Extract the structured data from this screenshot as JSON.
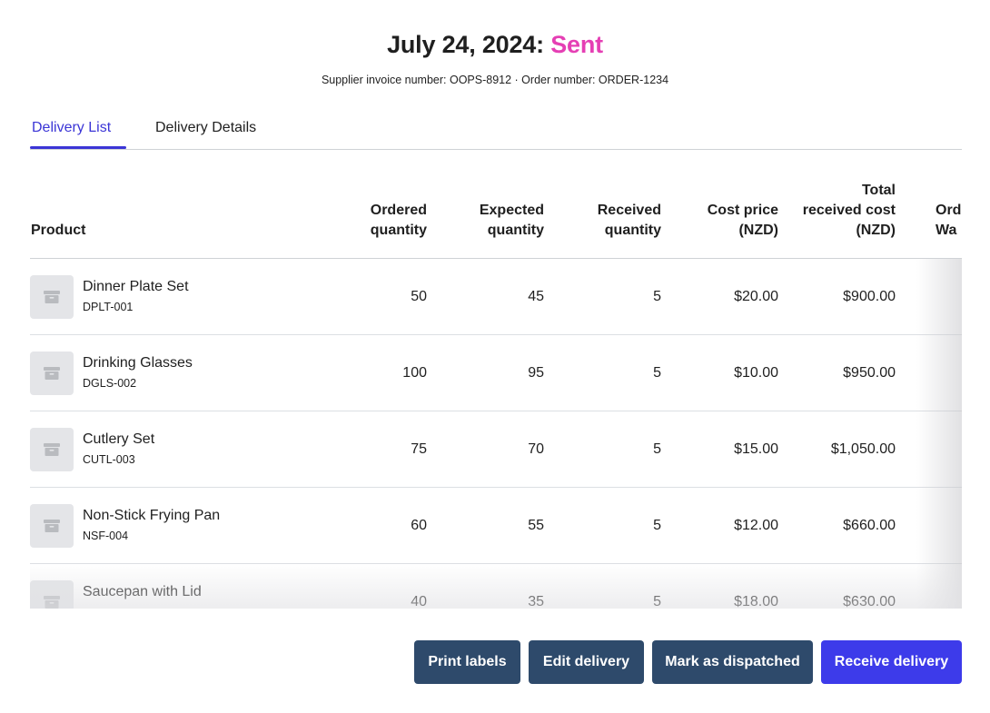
{
  "header": {
    "date": "July 24, 2024:",
    "status": "Sent",
    "status_color": "#e53fb4",
    "subtitle": "Supplier invoice number: OOPS-8912 ·  Order number: ORDER-1234"
  },
  "tabs": [
    {
      "label": "Delivery List",
      "active": true
    },
    {
      "label": "Delivery Details",
      "active": false
    }
  ],
  "table": {
    "columns": [
      "Product",
      "Ordered\nquantity",
      "Expected\nquantity",
      "Received\nquantity",
      "Cost price\n(NZD)",
      "Total\nreceived cost\n(NZD)",
      "Ord\nWa"
    ],
    "rows": [
      {
        "name": "Dinner Plate Set",
        "sku": "DPLT-001",
        "ordered": "50",
        "expected": "45",
        "received": "5",
        "cost": "$20.00",
        "total": "$900.00"
      },
      {
        "name": "Drinking Glasses",
        "sku": "DGLS-002",
        "ordered": "100",
        "expected": "95",
        "received": "5",
        "cost": "$10.00",
        "total": "$950.00"
      },
      {
        "name": "Cutlery Set",
        "sku": "CUTL-003",
        "ordered": "75",
        "expected": "70",
        "received": "5",
        "cost": "$15.00",
        "total": "$1,050.00"
      },
      {
        "name": "Non-Stick Frying Pan",
        "sku": "NSF-004",
        "ordered": "60",
        "expected": "55",
        "received": "5",
        "cost": "$12.00",
        "total": "$660.00"
      },
      {
        "name": "Saucepan with Lid",
        "sku": "",
        "ordered": "40",
        "expected": "35",
        "received": "5",
        "cost": "$18.00",
        "total": "$630.00"
      }
    ],
    "thumbnail_icon": "archive-box-icon"
  },
  "actions": {
    "print_labels": "Print labels",
    "edit_delivery": "Edit delivery",
    "mark_dispatched": "Mark as dispatched",
    "receive_delivery": "Receive delivery",
    "primary_color": "#3d3bea",
    "secondary_color": "#2e4a6b"
  }
}
